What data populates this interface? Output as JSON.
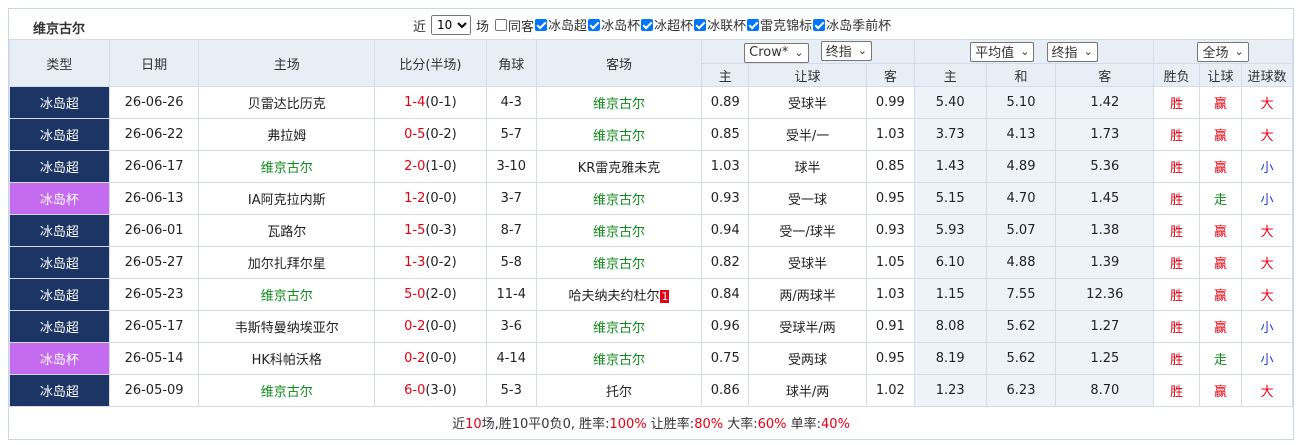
{
  "team_title": "维京古尔",
  "filters": {
    "recent_label": "近",
    "count_value": "10",
    "count_unit": "场",
    "same_home_label": "同客",
    "leagues": [
      {
        "label": "冰岛超",
        "checked": true
      },
      {
        "label": "冰岛杯",
        "checked": true
      },
      {
        "label": "冰超杯",
        "checked": true
      },
      {
        "label": "冰联杯",
        "checked": true
      },
      {
        "label": "雷克锦标",
        "checked": true
      },
      {
        "label": "冰岛季前杯",
        "checked": true
      }
    ]
  },
  "headers": {
    "type": "类型",
    "date": "日期",
    "home": "主场",
    "score": "比分(半场)",
    "corners": "角球",
    "away": "客场",
    "company_select": "Crow*",
    "odds_type_select": "终指",
    "avg_select": "平均值",
    "avg_odds_type_select": "终指",
    "range_select": "全场",
    "sub": {
      "h1": "主",
      "handicap": "让球",
      "a1": "客",
      "h2": "主",
      "draw": "和",
      "a2": "客",
      "result": "胜负",
      "hc_result": "让球",
      "goals": "进球数"
    }
  },
  "rows": [
    {
      "league": "冰岛超",
      "lg": "super",
      "date": "26-06-26",
      "home": "贝雷达比历克",
      "home_hl": false,
      "score_ft": "1-4",
      "score_ht": "(0-1)",
      "corners": "4-3",
      "away": "维京古尔",
      "away_hl": true,
      "away_badge": "",
      "h1": "0.89",
      "hc": "受球半",
      "a1": "0.99",
      "h2": "5.40",
      "d": "5.10",
      "a2": "1.42",
      "res": "胜",
      "hcres": "赢",
      "goals": "大",
      "goals_color": "red",
      "hc_color": "red"
    },
    {
      "league": "冰岛超",
      "lg": "super",
      "date": "26-06-22",
      "home": "弗拉姆",
      "home_hl": false,
      "score_ft": "0-5",
      "score_ht": "(0-2)",
      "corners": "5-7",
      "away": "维京古尔",
      "away_hl": true,
      "away_badge": "",
      "h1": "0.85",
      "hc": "受半/一",
      "a1": "1.03",
      "h2": "3.73",
      "d": "4.13",
      "a2": "1.73",
      "res": "胜",
      "hcres": "赢",
      "goals": "大",
      "goals_color": "red",
      "hc_color": "red"
    },
    {
      "league": "冰岛超",
      "lg": "super",
      "date": "26-06-17",
      "home": "维京古尔",
      "home_hl": true,
      "score_ft": "2-0",
      "score_ht": "(1-0)",
      "corners": "3-10",
      "away": "KR雷克雅未克",
      "away_hl": false,
      "away_badge": "",
      "h1": "1.03",
      "hc": "球半",
      "a1": "0.85",
      "h2": "1.43",
      "d": "4.89",
      "a2": "5.36",
      "res": "胜",
      "hcres": "赢",
      "goals": "小",
      "goals_color": "blue",
      "hc_color": "red"
    },
    {
      "league": "冰岛杯",
      "lg": "cup",
      "date": "26-06-13",
      "home": "IA阿克拉内斯",
      "home_hl": false,
      "score_ft": "1-2",
      "score_ht": "(0-0)",
      "corners": "3-7",
      "away": "维京古尔",
      "away_hl": true,
      "away_badge": "",
      "h1": "0.93",
      "hc": "受一球",
      "a1": "0.95",
      "h2": "5.15",
      "d": "4.70",
      "a2": "1.45",
      "res": "胜",
      "hcres": "走",
      "goals": "小",
      "goals_color": "blue",
      "hc_color": "green"
    },
    {
      "league": "冰岛超",
      "lg": "super",
      "date": "26-06-01",
      "home": "瓦路尔",
      "home_hl": false,
      "score_ft": "1-5",
      "score_ht": "(0-3)",
      "corners": "8-7",
      "away": "维京古尔",
      "away_hl": true,
      "away_badge": "",
      "h1": "0.94",
      "hc": "受一/球半",
      "a1": "0.93",
      "h2": "5.93",
      "d": "5.07",
      "a2": "1.38",
      "res": "胜",
      "hcres": "赢",
      "goals": "大",
      "goals_color": "red",
      "hc_color": "red"
    },
    {
      "league": "冰岛超",
      "lg": "super",
      "date": "26-05-27",
      "home": "加尔扎拜尔星",
      "home_hl": false,
      "score_ft": "1-3",
      "score_ht": "(0-2)",
      "corners": "5-8",
      "away": "维京古尔",
      "away_hl": true,
      "away_badge": "",
      "h1": "0.82",
      "hc": "受球半",
      "a1": "1.05",
      "h2": "6.10",
      "d": "4.88",
      "a2": "1.39",
      "res": "胜",
      "hcres": "赢",
      "goals": "大",
      "goals_color": "red",
      "hc_color": "red"
    },
    {
      "league": "冰岛超",
      "lg": "super",
      "date": "26-05-23",
      "home": "维京古尔",
      "home_hl": true,
      "score_ft": "5-0",
      "score_ht": "(2-0)",
      "corners": "11-4",
      "away": "哈夫纳夫约杜尔",
      "away_hl": false,
      "away_badge": "1",
      "h1": "0.84",
      "hc": "两/两球半",
      "a1": "1.03",
      "h2": "1.15",
      "d": "7.55",
      "a2": "12.36",
      "res": "胜",
      "hcres": "赢",
      "goals": "大",
      "goals_color": "red",
      "hc_color": "red"
    },
    {
      "league": "冰岛超",
      "lg": "super",
      "date": "26-05-17",
      "home": "韦斯特曼纳埃亚尔",
      "home_hl": false,
      "score_ft": "0-2",
      "score_ht": "(0-0)",
      "corners": "3-6",
      "away": "维京古尔",
      "away_hl": true,
      "away_badge": "",
      "h1": "0.96",
      "hc": "受球半/两",
      "a1": "0.91",
      "h2": "8.08",
      "d": "5.62",
      "a2": "1.27",
      "res": "胜",
      "hcres": "赢",
      "goals": "小",
      "goals_color": "blue",
      "hc_color": "red"
    },
    {
      "league": "冰岛杯",
      "lg": "cup",
      "date": "26-05-14",
      "home": "HK科帕沃格",
      "home_hl": false,
      "score_ft": "0-2",
      "score_ht": "(0-0)",
      "corners": "4-14",
      "away": "维京古尔",
      "away_hl": true,
      "away_badge": "",
      "h1": "0.75",
      "hc": "受两球",
      "a1": "0.95",
      "h2": "8.19",
      "d": "5.62",
      "a2": "1.25",
      "res": "胜",
      "hcres": "走",
      "goals": "小",
      "goals_color": "blue",
      "hc_color": "green"
    },
    {
      "league": "冰岛超",
      "lg": "super",
      "date": "26-05-09",
      "home": "维京古尔",
      "home_hl": true,
      "score_ft": "6-0",
      "score_ht": "(3-0)",
      "corners": "5-3",
      "away": "托尔",
      "away_hl": false,
      "away_badge": "",
      "h1": "0.86",
      "hc": "球半/两",
      "a1": "1.02",
      "h2": "1.23",
      "d": "6.23",
      "a2": "8.70",
      "res": "胜",
      "hcres": "赢",
      "goals": "大",
      "goals_color": "red",
      "hc_color": "red"
    }
  ],
  "summary": {
    "prefix": "近",
    "count": "10",
    "mid": "场,胜10平0负0, 胜率:",
    "win_rate": "100%",
    "hc_label": " 让胜率:",
    "hc_rate": "80%",
    "big_label": " 大率:",
    "big_rate": "60%",
    "odd_label": " 单率:",
    "odd_rate": "40%"
  }
}
